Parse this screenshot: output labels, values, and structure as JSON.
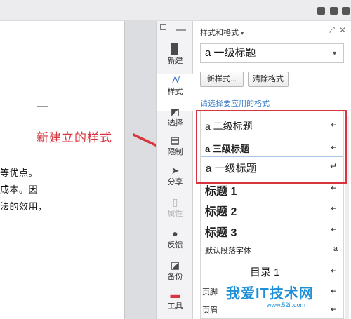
{
  "colors": {
    "annotation": "#d8363e",
    "accent_blue": "#3a7ec9",
    "watermark": "#1f8fd8"
  },
  "document": {
    "lines": [
      "等优点。",
      "成本。因",
      "法的效用，"
    ]
  },
  "annotation": {
    "text": "新建立的样式"
  },
  "sidebar": {
    "items": [
      {
        "label": "新建",
        "icon": "new-document-icon"
      },
      {
        "label": "样式",
        "icon": "styles-icon"
      },
      {
        "label": "选择",
        "icon": "select-icon"
      },
      {
        "label": "限制",
        "icon": "restrict-icon"
      },
      {
        "label": "分享",
        "icon": "share-icon"
      },
      {
        "label": "属性",
        "icon": "properties-icon"
      },
      {
        "label": "反馈",
        "icon": "feedback-icon"
      },
      {
        "label": "备份",
        "icon": "backup-icon"
      },
      {
        "label": "工具",
        "icon": "tools-icon"
      }
    ]
  },
  "panel": {
    "title": "样式和格式",
    "current_style": "a 一级标题",
    "new_style_button": "新样式...",
    "clear_format_button": "清除格式",
    "hint": "请选择要应用的格式",
    "styles": [
      {
        "name": "a 二级标题",
        "mark": "↵"
      },
      {
        "name": "a 三级标题",
        "mark": "↵"
      },
      {
        "name": "a 一级标题",
        "mark": "↵"
      },
      {
        "name": "标题  1",
        "mark": "↵"
      },
      {
        "name": "标题  2",
        "mark": "↵"
      },
      {
        "name": "标题  3",
        "mark": "↵"
      },
      {
        "name": "默认段落字体",
        "mark": "a"
      },
      {
        "name": "目录 1",
        "mark": "↵"
      },
      {
        "name": "页脚",
        "mark": "↵"
      },
      {
        "name": "页眉",
        "mark": "↵"
      }
    ]
  },
  "watermark": {
    "text": "我爱IT技术网",
    "url": "www.52ij.com"
  }
}
